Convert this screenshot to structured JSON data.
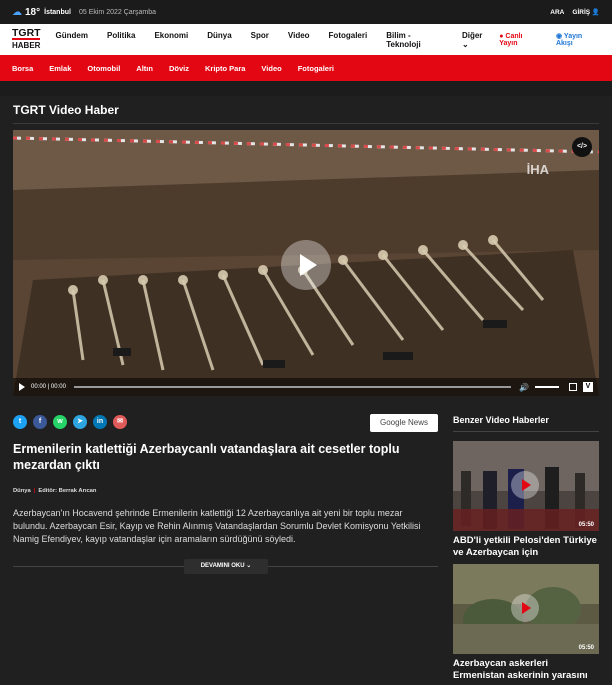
{
  "topbar": {
    "temp": "18°",
    "city": "İstanbul",
    "date": "05 Ekim 2022 Çarşamba",
    "search_label": "ARA",
    "login_label": "GİRİŞ"
  },
  "brand": {
    "line1": "TGRT",
    "line2": "HABER"
  },
  "mainnav": {
    "items": [
      "Gündem",
      "Politika",
      "Ekonomi",
      "Dünya",
      "Spor",
      "Video",
      "Fotogaleri",
      "Bilim - Teknoloji",
      "Diğer"
    ],
    "live_label": "Canlı Yayın",
    "air_label": "Yayın Akışı"
  },
  "subnav": {
    "items": [
      "Borsa",
      "Emlak",
      "Otomobil",
      "Altın",
      "Döviz",
      "Kripto Para",
      "Video",
      "Fotogaleri"
    ]
  },
  "section": {
    "title": "TGRT Video Haber"
  },
  "video": {
    "watermark": "İHA",
    "embed_label": "</>",
    "time": "00:00 | 00:00"
  },
  "share": {
    "google_news": "Google News"
  },
  "article": {
    "headline": "Ermenilerin katlettiği Azerbaycanlı vatandaşlara ait cesetler toplu mezardan çıktı",
    "category": "Dünya",
    "editor": "Editör: Berrak Arıcan",
    "summary": "Azerbaycan'ın Hocavend şehrinde Ermenilerin katlettiği 12 Azerbaycanlıya ait yeni bir toplu mezar bulundu. Azerbaycan Esir, Kayıp ve Rehin Alınmış Vatandaşlardan Sorumlu Devlet Komisyonu Yetkilisi Namig Efendiyev, kayıp vatandaşlar için aramaların sürdüğünü söyledi.",
    "more_label": "DEVAMINI OKU"
  },
  "related": {
    "title": "Benzer Video Haberler",
    "items": [
      {
        "caption": "ABD'li yetkili Pelosi'den Türkiye ve Azerbaycan için",
        "duration": "05:50"
      },
      {
        "caption": "Azerbaycan askerleri Ermenistan askerinin yarasını",
        "duration": "05:50"
      }
    ]
  },
  "colors": {
    "accent": "#e30613",
    "bg": "#202020",
    "link": "#1d76d6"
  }
}
